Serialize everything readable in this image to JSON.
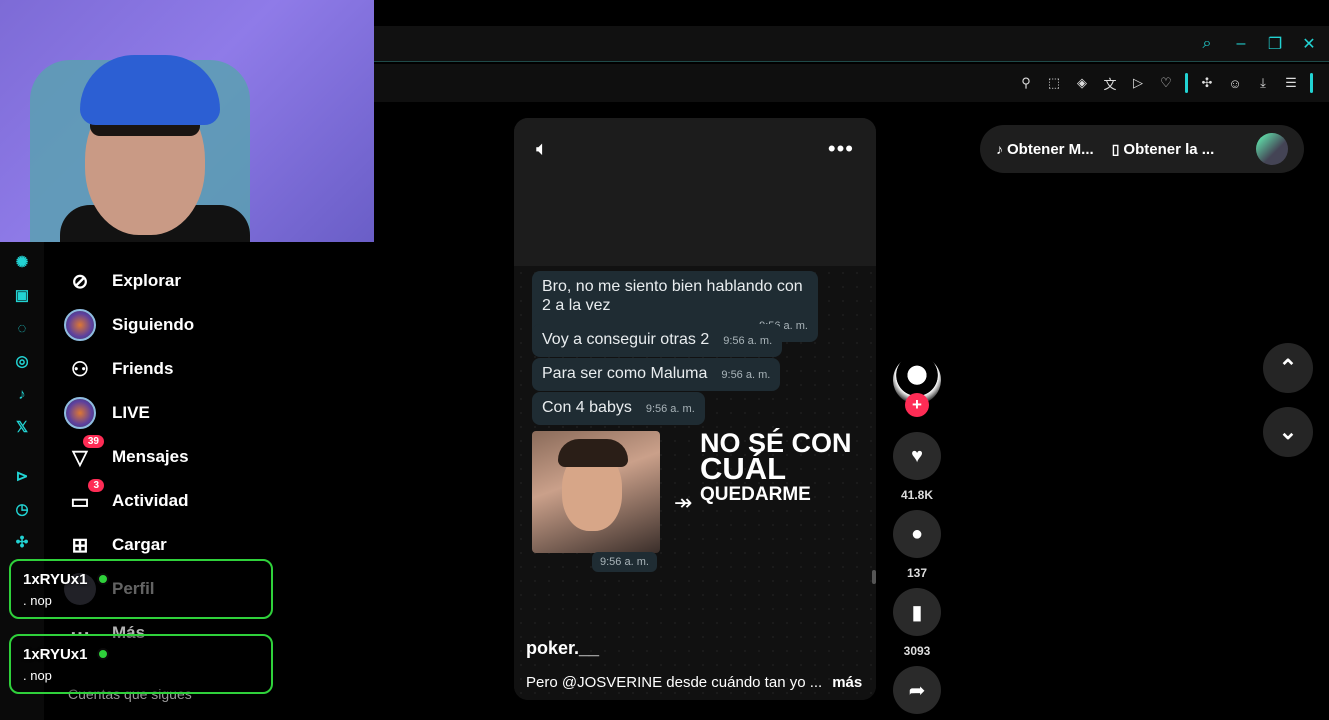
{
  "browser": {
    "window_controls": [
      "search-icon",
      "minimize-icon",
      "restore-icon",
      "close-icon"
    ],
    "toolbar_icons": [
      "pin-icon",
      "screenshot-icon",
      "pocket-icon",
      "translate-icon",
      "send-icon",
      "heart-icon",
      "extensions-icon",
      "profile-icon",
      "download-icon",
      "menu-icon"
    ]
  },
  "sidebar": {
    "rail_icons": [
      "chatgpt-icon",
      "twitch-icon",
      "whatsapp-icon",
      "instagram-icon",
      "tiktok-icon",
      "x-icon",
      "play-icon",
      "history-icon",
      "extension-icon"
    ],
    "items": [
      {
        "label": "Explorar",
        "icon": "compass-icon"
      },
      {
        "label": "Siguiendo",
        "icon": "following-avatar-icon"
      },
      {
        "label": "Friends",
        "icon": "friends-icon"
      },
      {
        "label": "LIVE",
        "icon": "live-avatar-icon"
      },
      {
        "label": "Mensajes",
        "icon": "messages-icon",
        "badge": "39"
      },
      {
        "label": "Actividad",
        "icon": "activity-icon",
        "badge": "3"
      },
      {
        "label": "Cargar",
        "icon": "upload-icon"
      },
      {
        "label": "Perfil",
        "icon": "profile-avatar-icon"
      },
      {
        "label": "Más",
        "icon": "more-icon"
      }
    ],
    "following_header": "Cuentas que sigues"
  },
  "overlays": [
    {
      "name": "1xRYUx1",
      "sub": ". nop"
    },
    {
      "name": "1xRYUx1",
      "sub": ". nop"
    }
  ],
  "video": {
    "messages": [
      {
        "text": "Bro, no me siento bien hablando con 2 a la vez",
        "time": "9:56 a. m."
      },
      {
        "text": "Voy a conseguir otras 2",
        "time": "9:56 a. m."
      },
      {
        "text": "Para ser como Maluma",
        "time": "9:56 a. m."
      },
      {
        "text": "Con 4 babys",
        "time": "9:56 a. m."
      }
    ],
    "image_text": {
      "line1": "NO SÉ CON",
      "line2": "CUÁL",
      "line3": "QUEDARME"
    },
    "image_time": "9:56 a. m.",
    "author": "poker.__",
    "caption": "Pero @JOSVERINE desde cuándo tan yo ...",
    "more_label": "más"
  },
  "actions": {
    "likes": "41.8K",
    "comments": "137",
    "saves": "3093"
  },
  "top_right": {
    "btn1": "Obtener M...",
    "btn2": "Obtener la ..."
  },
  "colors": {
    "accent": "#22d3d3",
    "tiktok_red": "#fe2c55",
    "overlay_green": "#2fd13b"
  }
}
